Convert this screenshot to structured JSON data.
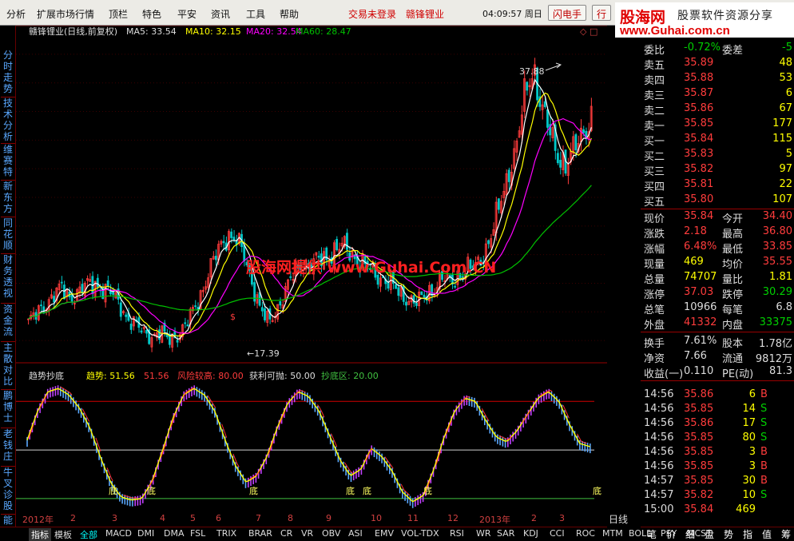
{
  "menu": {
    "items": [
      "分析",
      "扩展市场行情",
      "顶栏",
      "特色",
      "平安",
      "资讯",
      "工具",
      "帮助"
    ],
    "trade_status": "交易未登录",
    "stock_name": "赣锋锂业",
    "time": "04:09:57 周日",
    "btn_flash": "闪电手",
    "btn_row": "行"
  },
  "logo": {
    "name": "股海网",
    "slogan": "股票软件资源分享",
    "url": "www.Guhai.com.cn"
  },
  "sidebar": {
    "tabs": [
      "分时走势",
      "技术分析",
      "维赛特",
      "新东方",
      "同花顺",
      "财务透视",
      "资金流",
      "主散对比",
      "鹏博士",
      "老钱庄",
      "牛叉诊股",
      "能"
    ]
  },
  "chart_head": {
    "title": "赣锋锂业(日线,前复权)",
    "ma5": "MA5: 33.54",
    "ma10": "MA10: 32.15",
    "ma20": "MA20: 32.54",
    "ma60": "MA60: 28.47"
  },
  "annotations": {
    "high": "37.88",
    "low": "17.39",
    "watermark": "股海网提供 www.Guhai.Com.CN",
    "di": "底"
  },
  "indicator": {
    "name": "趋势抄底",
    "trend_label": "趋势: 51.56",
    "trend_val2": "51.56",
    "risk": "风险较高: 80.00",
    "profit": "获利可抛: 50.00",
    "bottom": "抄底区: 20.00"
  },
  "chart_data": [
    {
      "type": "candlestick",
      "title": "赣锋锂业(日线,前复权)",
      "y_ticks": [
        "38.00",
        "36.00",
        "34.00",
        "32.00",
        "30.00",
        "28.00",
        "26.00",
        "24.00",
        "22.00",
        "20.00",
        "18.00"
      ],
      "ylim": [
        17,
        39
      ],
      "series": [
        {
          "name": "MA5",
          "last": 33.54,
          "color": "#ffffff"
        },
        {
          "name": "MA10",
          "last": 32.15,
          "color": "#ffff00"
        },
        {
          "name": "MA20",
          "last": 32.54,
          "color": "#ff00ff"
        },
        {
          "name": "MA60",
          "last": 28.47,
          "color": "#00c000"
        }
      ],
      "period_high": 37.88,
      "period_low": 17.39,
      "close_path": [
        19.3,
        19.8,
        20.5,
        21.2,
        21.6,
        21.0,
        21.4,
        21.8,
        22.0,
        21.6,
        21.3,
        20.6,
        19.5,
        19.0,
        18.6,
        18.3,
        18.5,
        18.1,
        18.4,
        19.0,
        20.2,
        21.5,
        23.0,
        24.4,
        25.4,
        25.1,
        24.0,
        22.2,
        20.2,
        19.2,
        20.2,
        21.4,
        22.6,
        23.4,
        23.2,
        23.6,
        23.8,
        24.3,
        24.6,
        24.1,
        23.5,
        23.1,
        22.6,
        22.3,
        21.8,
        21.2,
        20.9,
        20.6,
        21.2,
        21.7,
        22.3,
        22.1,
        22.6,
        22.9,
        23.2,
        24.1,
        25.4,
        27.6,
        29.8,
        31.6,
        35.2,
        37.2,
        34.2,
        32.5,
        31.0,
        30.2,
        31.4,
        32.7,
        33.5
      ]
    },
    {
      "type": "line",
      "title": "趋势抄底",
      "y_ticks": [
        "75.00",
        "60.00",
        "45.00",
        "30.00"
      ],
      "ylim": [
        13,
        92
      ],
      "series": [
        {
          "name": "趋势",
          "last": 51.56,
          "color": "#ffff00"
        },
        {
          "name": "风险较高",
          "value": 80.0,
          "color": "#d00000"
        },
        {
          "name": "获利可抛",
          "value": 50.0,
          "color": "#d0d0d0"
        },
        {
          "name": "抄底区",
          "value": 20.0,
          "color": "#40c040"
        }
      ],
      "trend_path": [
        56,
        74,
        86,
        88,
        84,
        76,
        64,
        46,
        30,
        21,
        19,
        20,
        31,
        50,
        70,
        84,
        88,
        84,
        74,
        56,
        40,
        30,
        34,
        46,
        64,
        79,
        86,
        83,
        74,
        59,
        44,
        34,
        38,
        51,
        46,
        37,
        24,
        18,
        22,
        38,
        58,
        74,
        82,
        80,
        68,
        58,
        55,
        62,
        72,
        82,
        86,
        80,
        66,
        54,
        52
      ]
    }
  ],
  "right_panel": {
    "rows": [
      {
        "l": "委比",
        "v": "-0.72%",
        "l2": "委差",
        "v2": "-5",
        "vc": "green",
        "v2c": "green"
      },
      {
        "l": "卖五",
        "v": "35.89",
        "l2": "",
        "v2": "48",
        "vc": "red",
        "v2c": "yellow"
      },
      {
        "l": "卖四",
        "v": "35.88",
        "l2": "",
        "v2": "53",
        "vc": "red",
        "v2c": "yellow"
      },
      {
        "l": "卖三",
        "v": "35.87",
        "l2": "",
        "v2": "6",
        "vc": "red",
        "v2c": "yellow"
      },
      {
        "l": "卖二",
        "v": "35.86",
        "l2": "",
        "v2": "67",
        "vc": "red",
        "v2c": "yellow"
      },
      {
        "l": "卖一",
        "v": "35.85",
        "l2": "",
        "v2": "177",
        "vc": "red",
        "v2c": "yellow"
      },
      {
        "l": "买一",
        "v": "35.84",
        "l2": "",
        "v2": "115",
        "vc": "red",
        "v2c": "yellow"
      },
      {
        "l": "买二",
        "v": "35.83",
        "l2": "",
        "v2": "5",
        "vc": "red",
        "v2c": "yellow"
      },
      {
        "l": "买三",
        "v": "35.82",
        "l2": "",
        "v2": "97",
        "vc": "red",
        "v2c": "yellow"
      },
      {
        "l": "买四",
        "v": "35.81",
        "l2": "",
        "v2": "22",
        "vc": "red",
        "v2c": "yellow"
      },
      {
        "l": "买五",
        "v": "35.80",
        "l2": "",
        "v2": "107",
        "vc": "red",
        "v2c": "yellow"
      },
      {
        "l": "现价",
        "v": "35.84",
        "l2": "今开",
        "v2": "34.40",
        "vc": "red",
        "v2c": "red"
      },
      {
        "l": "涨跌",
        "v": "2.18",
        "l2": "最高",
        "v2": "36.80",
        "vc": "red",
        "v2c": "red"
      },
      {
        "l": "涨幅",
        "v": "6.48%",
        "l2": "最低",
        "v2": "33.85",
        "vc": "red",
        "v2c": "red"
      },
      {
        "l": "现量",
        "v": "469",
        "l2": "均价",
        "v2": "35.55",
        "vc": "yellow",
        "v2c": "red"
      },
      {
        "l": "总量",
        "v": "74707",
        "l2": "量比",
        "v2": "1.81",
        "vc": "yellow",
        "v2c": "yellow"
      },
      {
        "l": "涨停",
        "v": "37.03",
        "l2": "跌停",
        "v2": "30.29",
        "vc": "red",
        "v2c": "green"
      },
      {
        "l": "总笔",
        "v": "10966",
        "l2": "每笔",
        "v2": "6.8",
        "vc": "white",
        "v2c": "white"
      },
      {
        "l": "外盘",
        "v": "41332",
        "l2": "内盘",
        "v2": "33375",
        "vc": "red",
        "v2c": "green"
      },
      {
        "l": "换手",
        "v": "7.61%",
        "l2": "股本",
        "v2": "1.78亿",
        "vc": "white",
        "v2c": "white"
      },
      {
        "l": "净资",
        "v": "7.66",
        "l2": "流通",
        "v2": "9812万",
        "vc": "white",
        "v2c": "white"
      },
      {
        "l": "收益(一)",
        "v": "0.110",
        "l2": "PE(动)",
        "v2": "81.3",
        "vc": "white",
        "v2c": "white"
      }
    ],
    "ticks": [
      {
        "t": "14:56",
        "p": "35.86",
        "v": "6",
        "d": "B"
      },
      {
        "t": "14:56",
        "p": "35.85",
        "v": "14",
        "d": "S"
      },
      {
        "t": "14:56",
        "p": "35.86",
        "v": "17",
        "d": "S"
      },
      {
        "t": "14:56",
        "p": "35.85",
        "v": "80",
        "d": "S"
      },
      {
        "t": "14:56",
        "p": "35.85",
        "v": "3",
        "d": "B"
      },
      {
        "t": "14:56",
        "p": "35.85",
        "v": "3",
        "d": "B"
      },
      {
        "t": "14:57",
        "p": "35.85",
        "v": "30",
        "d": "B"
      },
      {
        "t": "14:57",
        "p": "35.82",
        "v": "10",
        "d": "S"
      },
      {
        "t": "15:00",
        "p": "35.84",
        "v": "469",
        "d": ""
      }
    ]
  },
  "date_axis": {
    "labels": [
      "2012年",
      "2",
      "3",
      "4",
      "5",
      "6",
      "7",
      "8",
      "9",
      "10",
      "11",
      "12",
      "2013年",
      "2",
      "3"
    ],
    "period": "日线"
  },
  "bottom_tabs": [
    "指标",
    "模板",
    "全部",
    "MACD",
    "DMI",
    "DMA",
    "FSL",
    "TRIX",
    "BRAR",
    "CR",
    "VR",
    "OBV",
    "ASI",
    "EMV",
    "VOL-TDX",
    "RSI",
    "WR",
    "SAR",
    "KDJ",
    "CCI",
    "ROC",
    "MTM",
    "BOLL",
    "PSY",
    "MCST"
  ],
  "right_tabs": [
    "笔",
    "价",
    "细",
    "盘",
    "势",
    "指",
    "值",
    "筹"
  ],
  "colors": {
    "up": "#ff3c3c",
    "down": "#00c8c8",
    "ma5": "#ffffff",
    "ma10": "#ffff00",
    "ma20": "#ff00ff",
    "ma60": "#00c000",
    "grid": "#8b0000"
  }
}
